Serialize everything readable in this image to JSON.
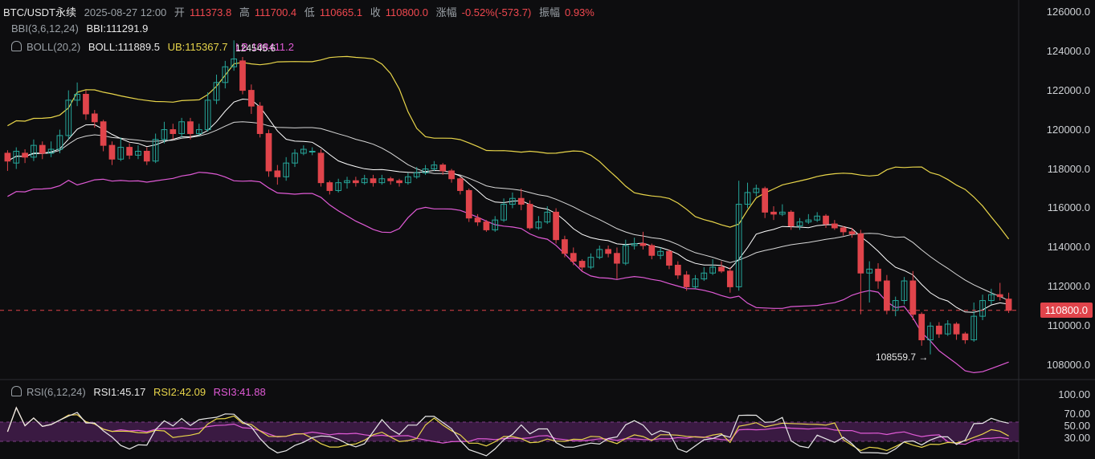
{
  "header": {
    "symbol": "BTC/USDT永续",
    "datetime": "2025-08-27 12:00",
    "open_label": "开",
    "open": "111373.8",
    "high_label": "高",
    "high": "111700.4",
    "low_label": "低",
    "low": "110665.1",
    "close_label": "收",
    "close": "110800.0",
    "change_label": "涨幅",
    "change": "-0.52%(-573.7)",
    "amp_label": "振幅",
    "amp": "0.93%"
  },
  "indicators": {
    "bbi_name": "BBI(3,6,12,24)",
    "bbi_value": "BBI:111291.9",
    "boll_name": "BOLL(20,2)",
    "boll_value": "BOLL:111889.5",
    "boll_ub": "UB:115367.7",
    "boll_lb": "LB:108411.2",
    "rsi_name": "RSI(6,12,24)",
    "rsi1": "RSI1:45.17",
    "rsi2": "RSI2:42.09",
    "rsi3": "RSI3:41.88"
  },
  "annotations": {
    "high_mark": "124545.6",
    "low_mark": "108559.7 →"
  },
  "current_price": "110800.0",
  "colors": {
    "up": "#26a69a",
    "down": "#e0444b",
    "ub": "#e8d54a",
    "lb": "#e05ad6",
    "mid": "#d8d8d8",
    "bg": "#0d0d0f"
  },
  "chart_data": {
    "type": "candlestick",
    "ylim": [
      107400,
      126600
    ],
    "yticks": [
      "126000.0",
      "124000.0",
      "122000.0",
      "120000.0",
      "118000.0",
      "116000.0",
      "114000.0",
      "112000.0",
      "110000.0",
      "108000.0"
    ],
    "rsi_ticks": [
      "100.00",
      "70.00",
      "50.00",
      "30.00"
    ],
    "candles": [
      [
        118800,
        118400,
        118950,
        117900
      ],
      [
        118300,
        118900,
        119100,
        118000
      ],
      [
        118800,
        118600,
        119000,
        118300
      ],
      [
        118600,
        119200,
        119500,
        118400
      ],
      [
        119200,
        118800,
        119400,
        118500
      ],
      [
        118800,
        119000,
        119400,
        118600
      ],
      [
        119000,
        119700,
        120000,
        118800
      ],
      [
        119700,
        121500,
        122000,
        119500
      ],
      [
        121500,
        121800,
        122400,
        121200
      ],
      [
        121800,
        120800,
        122000,
        120500
      ],
      [
        120800,
        120400,
        121000,
        120100
      ],
      [
        120400,
        119200,
        120500,
        118900
      ],
      [
        119200,
        118500,
        119400,
        118200
      ],
      [
        118500,
        119100,
        119600,
        118400
      ],
      [
        119100,
        118700,
        119300,
        118500
      ],
      [
        118700,
        118900,
        119200,
        118500
      ],
      [
        118900,
        118400,
        119100,
        118200
      ],
      [
        118400,
        119500,
        119800,
        118300
      ],
      [
        119500,
        120000,
        120400,
        119300
      ],
      [
        120000,
        119800,
        120300,
        119500
      ],
      [
        119800,
        120400,
        120600,
        119600
      ],
      [
        120400,
        119800,
        120600,
        119500
      ],
      [
        119800,
        120000,
        120300,
        119700
      ],
      [
        120000,
        121500,
        121900,
        119900
      ],
      [
        121500,
        122400,
        122800,
        121300
      ],
      [
        122400,
        123200,
        123500,
        122100
      ],
      [
        123200,
        123600,
        124545,
        123000
      ],
      [
        123500,
        122000,
        123700,
        121800
      ],
      [
        122000,
        121200,
        122300,
        120800
      ],
      [
        121200,
        119800,
        121400,
        119600
      ],
      [
        119800,
        117900,
        120000,
        117600
      ],
      [
        117900,
        117600,
        118200,
        117200
      ],
      [
        117600,
        118300,
        118600,
        117400
      ],
      [
        118300,
        118800,
        119000,
        118100
      ],
      [
        118800,
        119000,
        119200,
        118700
      ],
      [
        118900,
        118900,
        119100,
        118700
      ],
      [
        118800,
        117300,
        119000,
        117100
      ],
      [
        117300,
        116900,
        117400,
        116700
      ],
      [
        116900,
        117300,
        117500,
        116800
      ],
      [
        117300,
        117400,
        117600,
        117000
      ],
      [
        117400,
        117300,
        117600,
        117100
      ],
      [
        117300,
        117500,
        117700,
        117200
      ],
      [
        117500,
        117300,
        117700,
        117100
      ],
      [
        117300,
        117500,
        117700,
        117200
      ],
      [
        117500,
        117400,
        117600,
        117200
      ],
      [
        117400,
        117300,
        117500,
        117100
      ],
      [
        117300,
        117600,
        117800,
        117200
      ],
      [
        117600,
        117800,
        118100,
        117500
      ],
      [
        117800,
        118000,
        118200,
        117700
      ],
      [
        118000,
        118200,
        118400,
        117900
      ],
      [
        118200,
        117900,
        118300,
        117700
      ],
      [
        117900,
        117500,
        118000,
        117300
      ],
      [
        117500,
        116900,
        117600,
        116700
      ],
      [
        116900,
        115500,
        117000,
        115300
      ],
      [
        115500,
        115300,
        115700,
        115100
      ],
      [
        115300,
        114900,
        115400,
        114800
      ],
      [
        114900,
        115400,
        115600,
        114800
      ],
      [
        115400,
        116200,
        116500,
        115300
      ],
      [
        116200,
        116500,
        116800,
        116000
      ],
      [
        116500,
        116200,
        117000,
        115900
      ],
      [
        116200,
        115000,
        116400,
        114900
      ],
      [
        115000,
        115300,
        115600,
        114900
      ],
      [
        115300,
        115800,
        116100,
        115200
      ],
      [
        115800,
        114400,
        116000,
        114200
      ],
      [
        114400,
        113700,
        114600,
        113500
      ],
      [
        113700,
        113300,
        114000,
        113100
      ],
      [
        113300,
        113000,
        113400,
        112800
      ],
      [
        113000,
        113500,
        113700,
        112900
      ],
      [
        113500,
        113900,
        114100,
        113400
      ],
      [
        113900,
        113700,
        114100,
        113500
      ],
      [
        113700,
        113200,
        114000,
        112400
      ],
      [
        113200,
        114100,
        114400,
        113100
      ],
      [
        114100,
        114200,
        114500,
        113900
      ],
      [
        114200,
        114100,
        114800,
        113900
      ],
      [
        114100,
        113600,
        114200,
        113400
      ],
      [
        113600,
        113800,
        114000,
        113400
      ],
      [
        113800,
        113100,
        113900,
        112900
      ],
      [
        113100,
        112600,
        113300,
        112400
      ],
      [
        112600,
        112000,
        112800,
        111800
      ],
      [
        112000,
        112400,
        112600,
        111900
      ],
      [
        112400,
        112700,
        113000,
        112300
      ],
      [
        112700,
        113000,
        113400,
        112600
      ],
      [
        113000,
        112800,
        113300,
        112700
      ],
      [
        112800,
        112000,
        113000,
        111700
      ],
      [
        112000,
        116200,
        117400,
        111800
      ],
      [
        116200,
        116800,
        117300,
        116000
      ],
      [
        116800,
        117000,
        117200,
        116600
      ],
      [
        117000,
        115800,
        117100,
        115500
      ],
      [
        115800,
        115700,
        116100,
        115400
      ],
      [
        115700,
        115800,
        116200,
        115600
      ],
      [
        115800,
        115100,
        115900,
        114900
      ],
      [
        115100,
        115300,
        115500,
        114900
      ],
      [
        115300,
        115400,
        115700,
        115200
      ],
      [
        115400,
        115600,
        115800,
        115300
      ],
      [
        115600,
        115200,
        115700,
        115000
      ],
      [
        115200,
        115000,
        115400,
        114900
      ],
      [
        115000,
        114800,
        115100,
        114600
      ],
      [
        114800,
        114700,
        115000,
        114500
      ],
      [
        114700,
        112700,
        114900,
        110600
      ],
      [
        112700,
        112900,
        113300,
        111200
      ],
      [
        112900,
        112300,
        113200,
        111900
      ],
      [
        112300,
        110800,
        112600,
        110600
      ],
      [
        110800,
        111300,
        111500,
        110500
      ],
      [
        111300,
        112300,
        112500,
        111100
      ],
      [
        112300,
        110600,
        112800,
        110300
      ],
      [
        110600,
        109300,
        110700,
        109000
      ],
      [
        109300,
        110000,
        110200,
        108559
      ],
      [
        110000,
        109600,
        110200,
        109400
      ],
      [
        109600,
        110100,
        110300,
        109500
      ],
      [
        110100,
        109600,
        110200,
        109300
      ],
      [
        109600,
        109300,
        109700,
        109100
      ],
      [
        109300,
        110500,
        111200,
        109200
      ],
      [
        110500,
        111300,
        111600,
        110300
      ],
      [
        111300,
        111600,
        111900,
        111100
      ],
      [
        111600,
        111500,
        112200,
        111300
      ],
      [
        111373,
        110800,
        111700,
        110665
      ]
    ]
  }
}
